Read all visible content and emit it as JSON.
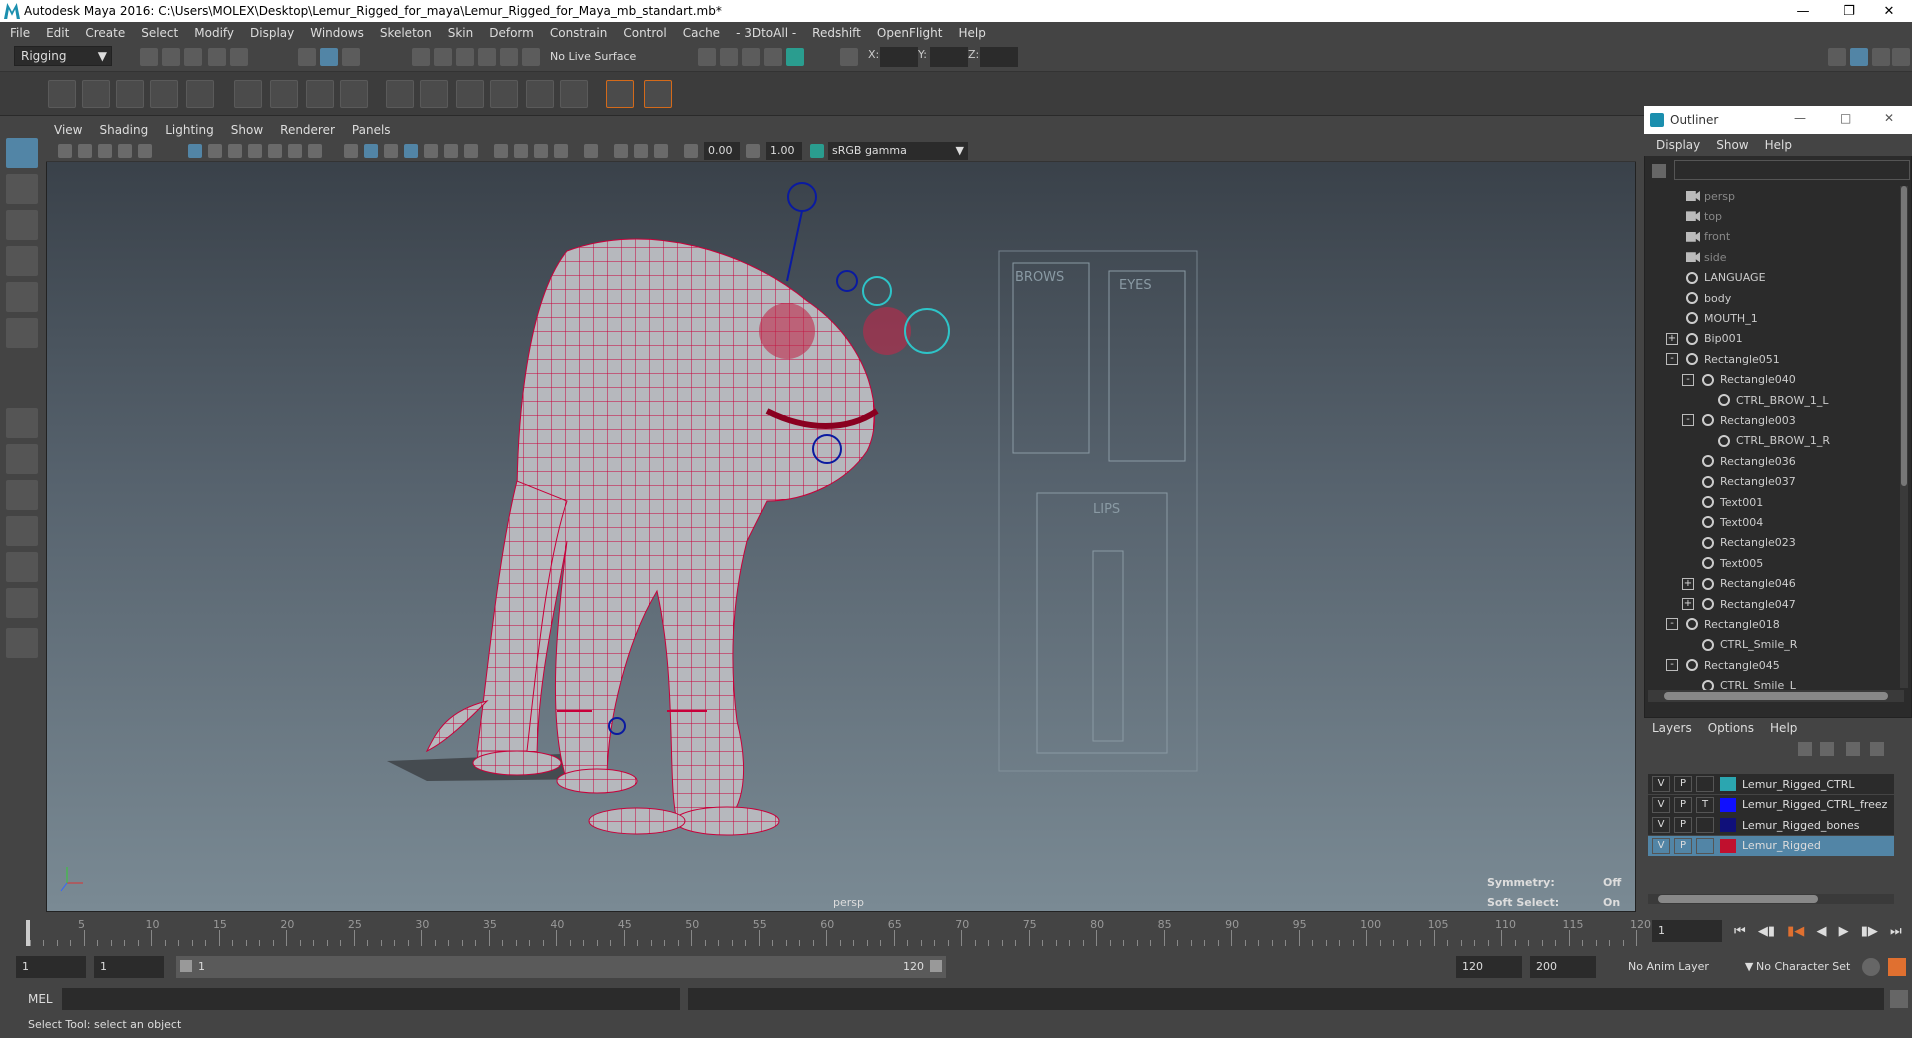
{
  "title": "Autodesk Maya 2016: C:\\Users\\MOLEX\\Desktop\\Lemur_Rigged_for_maya\\Lemur_Rigged_for_Maya_mb_standart.mb*",
  "menus": [
    "File",
    "Edit",
    "Create",
    "Select",
    "Modify",
    "Display",
    "Windows",
    "Skeleton",
    "Skin",
    "Deform",
    "Constrain",
    "Control",
    "Cache",
    "- 3DtoAll -",
    "Redshift",
    "OpenFlight",
    "Help"
  ],
  "mode_selector": "Rigging",
  "live_surface": "No Live Surface",
  "coord_labels": {
    "x": "X:",
    "y": "Y:",
    "z": "Z:"
  },
  "viewport": {
    "menus": [
      "View",
      "Shading",
      "Lighting",
      "Show",
      "Renderer",
      "Panels"
    ],
    "exposure": "0.00",
    "gamma": "1.00",
    "colorspace": "sRGB gamma",
    "camera_label": "persp",
    "hud": {
      "symmetry_label": "Symmetry:",
      "symmetry_value": "Off",
      "softselect_label": "Soft Select:",
      "softselect_value": "On"
    },
    "face_panel": {
      "brows": "BROWS",
      "eyes": "EYES",
      "lips": "LIPS"
    }
  },
  "outliner": {
    "title": "Outliner",
    "menus": [
      "Display",
      "Show",
      "Help"
    ],
    "items": [
      {
        "label": "persp",
        "kind": "cam",
        "indent": 0,
        "exp": ""
      },
      {
        "label": "top",
        "kind": "cam",
        "indent": 0,
        "exp": ""
      },
      {
        "label": "front",
        "kind": "cam",
        "indent": 0,
        "exp": ""
      },
      {
        "label": "side",
        "kind": "cam",
        "indent": 0,
        "exp": ""
      },
      {
        "label": "LANGUAGE",
        "kind": "xf",
        "indent": 0,
        "exp": ""
      },
      {
        "label": "body",
        "kind": "xf",
        "indent": 0,
        "exp": ""
      },
      {
        "label": "MOUTH_1",
        "kind": "xf",
        "indent": 0,
        "exp": ""
      },
      {
        "label": "Bip001",
        "kind": "xf",
        "indent": 0,
        "exp": "+"
      },
      {
        "label": "Rectangle051",
        "kind": "xf",
        "indent": 0,
        "exp": "-"
      },
      {
        "label": "Rectangle040",
        "kind": "xf",
        "indent": 1,
        "exp": "-"
      },
      {
        "label": "CTRL_BROW_1_L",
        "kind": "xf",
        "indent": 2,
        "exp": ""
      },
      {
        "label": "Rectangle003",
        "kind": "xf",
        "indent": 1,
        "exp": "-"
      },
      {
        "label": "CTRL_BROW_1_R",
        "kind": "xf",
        "indent": 2,
        "exp": ""
      },
      {
        "label": "Rectangle036",
        "kind": "xf",
        "indent": 1,
        "exp": ""
      },
      {
        "label": "Rectangle037",
        "kind": "xf",
        "indent": 1,
        "exp": ""
      },
      {
        "label": "Text001",
        "kind": "xf",
        "indent": 1,
        "exp": ""
      },
      {
        "label": "Text004",
        "kind": "xf",
        "indent": 1,
        "exp": ""
      },
      {
        "label": "Rectangle023",
        "kind": "xf",
        "indent": 1,
        "exp": ""
      },
      {
        "label": "Text005",
        "kind": "xf",
        "indent": 1,
        "exp": ""
      },
      {
        "label": "Rectangle046",
        "kind": "xf",
        "indent": 1,
        "exp": "+"
      },
      {
        "label": "Rectangle047",
        "kind": "xf",
        "indent": 1,
        "exp": "+"
      },
      {
        "label": "Rectangle018",
        "kind": "xf",
        "indent": 0,
        "exp": "-"
      },
      {
        "label": "CTRL_Smile_R",
        "kind": "xf",
        "indent": 1,
        "exp": ""
      },
      {
        "label": "Rectangle045",
        "kind": "xf",
        "indent": 0,
        "exp": "-"
      },
      {
        "label": "CTRL_Smile_L",
        "kind": "xf",
        "indent": 1,
        "exp": ""
      }
    ]
  },
  "layers": {
    "menus": [
      "Layers",
      "Options",
      "Help"
    ],
    "rows": [
      {
        "v": "V",
        "p": "P",
        "t": "",
        "color": "#2ba6b0",
        "name": "Lemur_Rigged_CTRL",
        "selected": false
      },
      {
        "v": "V",
        "p": "P",
        "t": "T",
        "color": "#1010ff",
        "name": "Lemur_Rigged_CTRL_freez",
        "selected": false
      },
      {
        "v": "V",
        "p": "P",
        "t": "",
        "color": "#10107a",
        "name": "Lemur_Rigged_bones",
        "selected": false
      },
      {
        "v": "V",
        "p": "P",
        "t": "",
        "color": "#c0102e",
        "name": "Lemur_Rigged",
        "selected": true
      }
    ]
  },
  "timeline": {
    "start": 1,
    "end": 120,
    "current": "1"
  },
  "range": {
    "start": "1",
    "anim_start": "1",
    "slider_start": "1",
    "slider_end": "120",
    "anim_end": "120",
    "max": "200",
    "anim_layer": "No Anim Layer",
    "char_set": "No Character Set"
  },
  "cmd": {
    "label": "MEL"
  },
  "help": "Select Tool: select an object",
  "colors": {
    "wire": "#c8003a",
    "ctrl": "#2ec4c8",
    "bone": "#0a1aa0"
  }
}
